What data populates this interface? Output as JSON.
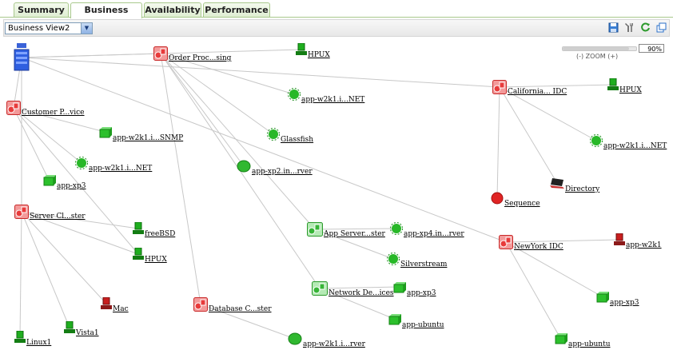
{
  "tabs": [
    {
      "label": "Summary",
      "active": false
    },
    {
      "label": "Business View",
      "active": true
    },
    {
      "label": "Availability",
      "active": false
    },
    {
      "label": "Performance",
      "active": false
    }
  ],
  "toolbar": {
    "view_select": "Business View2",
    "icons": [
      "save-icon",
      "tools-icon",
      "refresh-icon",
      "popout-icon"
    ]
  },
  "zoom": {
    "label": "(-) ZOOM (+)",
    "value": "90%",
    "level": 0.9
  },
  "colors": {
    "group_red": "#e83b3b",
    "monitor_green": "#1fae1f",
    "link_gray": "#c8c8c8",
    "tab_border": "#a9c98d"
  },
  "nodes": {
    "root": {
      "label": "",
      "type": "server-stack"
    },
    "order_processing": {
      "label": "Order Proc...sing",
      "type": "group"
    },
    "hpux_top": {
      "label": "HPUX",
      "type": "server"
    },
    "customer_portal": {
      "label": "Customer P...vice",
      "type": "group"
    },
    "app_w2k1_net_1": {
      "label": "app-w2k1.i...NET",
      "type": "net"
    },
    "app_w2k1_snmp": {
      "label": "app-w2k1.i...SNMP",
      "type": "snmp"
    },
    "glassfish": {
      "label": "Glassfish",
      "type": "gear"
    },
    "app_w2k1_net_2": {
      "label": "app-w2k1.i...NET",
      "type": "net"
    },
    "app_xp2": {
      "label": "app-xp2.in...rver",
      "type": "ora"
    },
    "app_xp3_left": {
      "label": "app-xp3",
      "type": "ping"
    },
    "california_idc": {
      "label": "California... IDC",
      "type": "group"
    },
    "hpux_right": {
      "label": "HPUX",
      "type": "server"
    },
    "app_w2k1_net_right": {
      "label": "app-w2k1.i...NET",
      "type": "net"
    },
    "directory": {
      "label": "Directory",
      "type": "laptop"
    },
    "sequence": {
      "label": "Sequence",
      "type": "ups"
    },
    "server_cluster": {
      "label": "Server Cl...ster",
      "type": "group"
    },
    "freebsd": {
      "label": "freeBSD",
      "type": "server"
    },
    "hpux_mid": {
      "label": "HPUX",
      "type": "server"
    },
    "app_servers": {
      "label": "App Server...ster",
      "type": "group-green"
    },
    "app_xp4": {
      "label": "app-xp4.in...rver",
      "type": "net"
    },
    "silverstream": {
      "label": "Silverstream",
      "type": "gear"
    },
    "newyork_idc": {
      "label": "NewYork IDC",
      "type": "group"
    },
    "app_w2k1_ny": {
      "label": "app-w2k1",
      "type": "server-red"
    },
    "network_devices": {
      "label": "Network De...ices",
      "type": "group-green"
    },
    "app_xp3_mid": {
      "label": "app-xp3",
      "type": "ping"
    },
    "app_xp3_right": {
      "label": "app-xp3",
      "type": "ping"
    },
    "mac": {
      "label": "Mac",
      "type": "server-red"
    },
    "database_cluster": {
      "label": "Database C...ster",
      "type": "group"
    },
    "app_ubuntu_mid": {
      "label": "app-ubuntu",
      "type": "ping"
    },
    "linux1": {
      "label": "Linux1",
      "type": "server"
    },
    "vista1": {
      "label": "Vista1",
      "type": "server"
    },
    "app_w2k1_ora": {
      "label": "app-w2k1.i...rver",
      "type": "ora"
    },
    "app_ubuntu_right": {
      "label": "app-ubuntu",
      "type": "ping"
    }
  }
}
